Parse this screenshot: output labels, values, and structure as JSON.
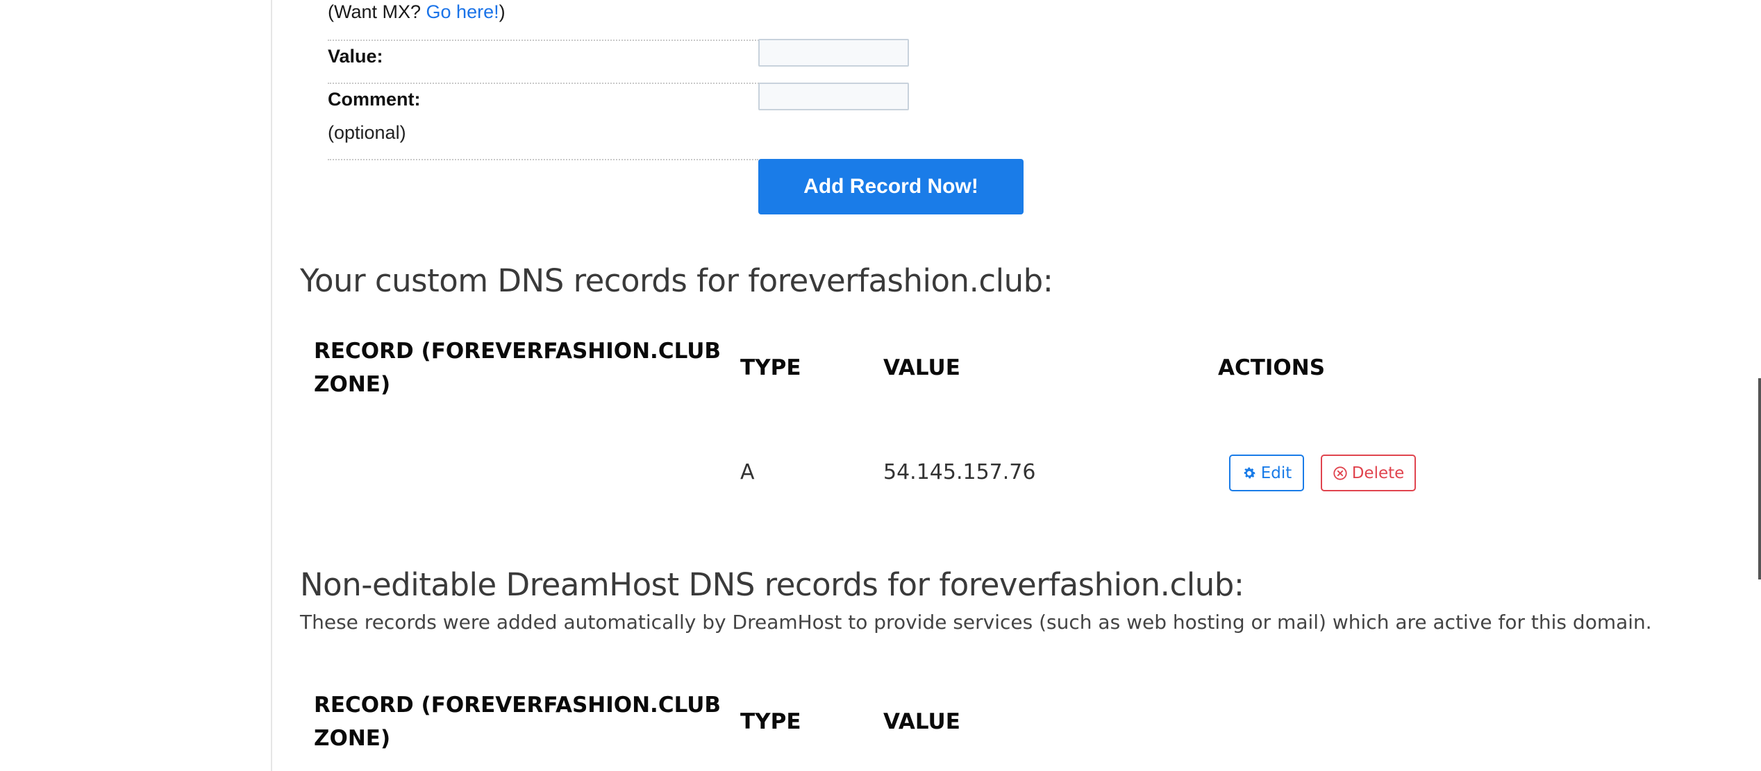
{
  "form": {
    "mx_prefix": "(Want MX? ",
    "mx_link": "Go here!",
    "mx_suffix": ")",
    "value_label": "Value:",
    "value_input": "",
    "comment_label": "Comment:",
    "comment_note": "(optional)",
    "comment_input": "",
    "submit_label": "Add Record Now!"
  },
  "custom_records": {
    "heading": "Your custom DNS records for foreverfashion.club:",
    "columns": {
      "record_line1": "RECORD (FOREVERFASHION.CLUB",
      "record_line2": "ZONE)",
      "type": "TYPE",
      "value": "VALUE",
      "actions": "ACTIONS"
    },
    "rows": [
      {
        "record": "",
        "type": "A",
        "value": "54.145.157.76",
        "edit_label": "Edit",
        "delete_label": "Delete"
      }
    ]
  },
  "dreamhost_records": {
    "heading": "Non-editable DreamHost DNS records for foreverfashion.club:",
    "description": "These records were added automatically by DreamHost to provide services (such as web hosting or mail) which are active for this domain.",
    "columns": {
      "record_line1": "RECORD (FOREVERFASHION.CLUB",
      "record_line2": "ZONE)",
      "type": "TYPE",
      "value": "VALUE"
    }
  },
  "colors": {
    "primary": "#1a7ce8",
    "danger": "#e0444e",
    "link": "#1a73e8"
  },
  "icons": {
    "edit": "gear-icon",
    "delete": "circle-x-icon"
  }
}
